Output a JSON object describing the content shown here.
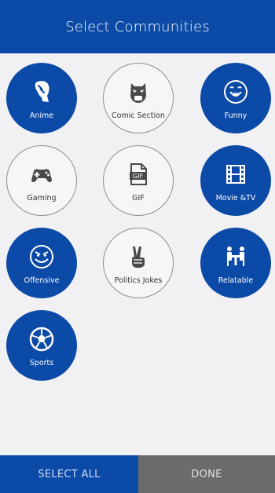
{
  "header": {
    "title": "Select Communities"
  },
  "communities": [
    {
      "label": "Anime",
      "icon": "anime-character-icon",
      "selected": true
    },
    {
      "label": "Comic Section",
      "icon": "mask-icon",
      "selected": false
    },
    {
      "label": "Funny",
      "icon": "laughing-face-icon",
      "selected": true
    },
    {
      "label": "Gaming",
      "icon": "gamepad-icon",
      "selected": false
    },
    {
      "label": "GIF",
      "icon": "gif-file-icon",
      "selected": false
    },
    {
      "label": "Movie &TV",
      "icon": "film-strip-icon",
      "selected": true
    },
    {
      "label": "Offensive",
      "icon": "evil-face-icon",
      "selected": true
    },
    {
      "label": "Politics Jokes",
      "icon": "peace-hand-icon",
      "selected": false
    },
    {
      "label": "Relatable",
      "icon": "people-at-table-icon",
      "selected": true
    },
    {
      "label": "Sports",
      "icon": "soccer-ball-icon",
      "selected": true
    }
  ],
  "footer": {
    "select_all": "SELECT ALL",
    "done": "DONE"
  },
  "colors": {
    "primary": "#0b4aa6",
    "done_bg": "#6b6b6b",
    "background": "#f1f0f3"
  }
}
